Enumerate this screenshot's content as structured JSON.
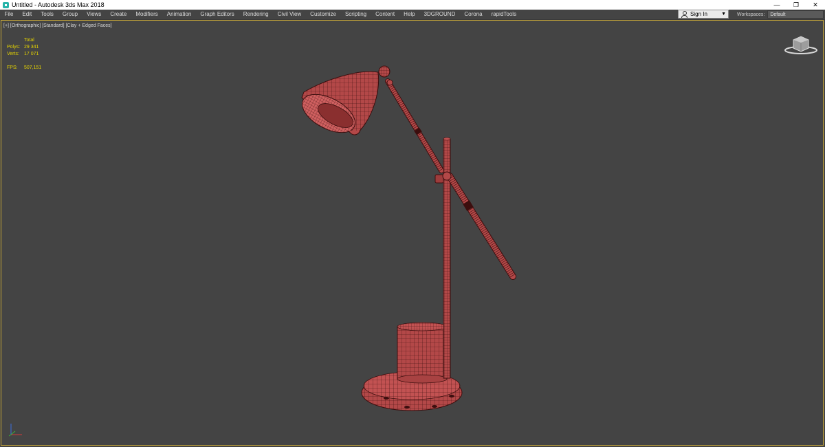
{
  "window": {
    "title": "Untitled - Autodesk 3ds Max 2018",
    "controls": [
      "—",
      "❐",
      "✕"
    ]
  },
  "menu": {
    "items": [
      "File",
      "Edit",
      "Tools",
      "Group",
      "Views",
      "Create",
      "Modifiers",
      "Animation",
      "Graph Editors",
      "Rendering",
      "Civil View",
      "Customize",
      "Scripting",
      "Content",
      "Help",
      "3DGROUND",
      "Corona",
      "rapidTools"
    ]
  },
  "account": {
    "signin_label": "Sign In",
    "caret": "▼"
  },
  "workspaces": {
    "label": "Workspaces:",
    "value": "Default"
  },
  "viewport": {
    "label": "[+] [Orthographic] [Standard] [Clay + Edged Faces]",
    "stats": {
      "header": "Total",
      "polys_label": "Polys:",
      "polys_value": "29 341",
      "verts_label": "Verts:",
      "verts_value": "17 071",
      "fps_label": "FPS:",
      "fps_value": "507,151"
    }
  },
  "colors": {
    "viewport_bg": "#444444",
    "model": "#b34848",
    "wire": "#3c0e0e",
    "stats_text": "#e5d300",
    "active_border": "#c8a838"
  },
  "icons": {
    "app": "3dsmax-app-icon",
    "user": "user-icon",
    "viewcube": "viewcube-icon",
    "axis": "axis-gizmo-icon"
  }
}
